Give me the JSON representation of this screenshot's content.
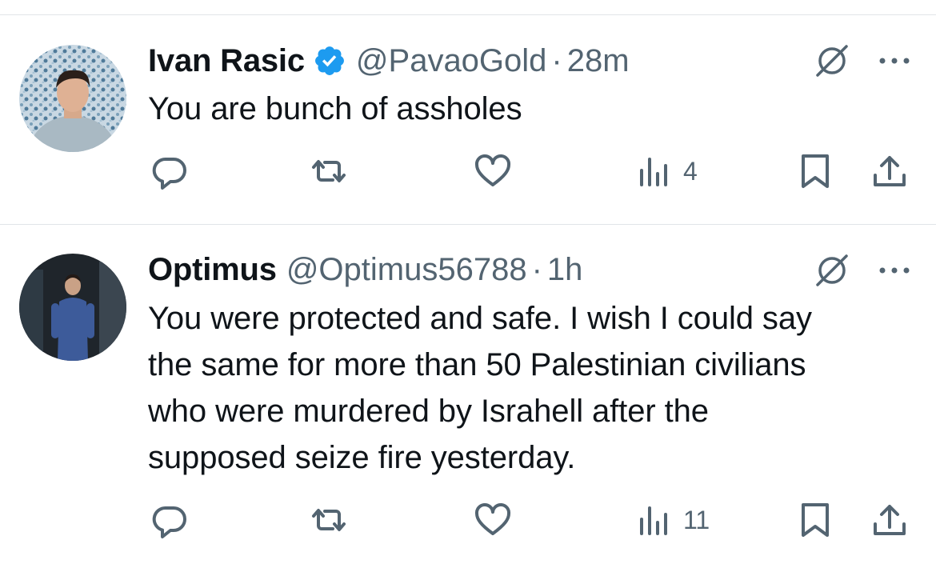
{
  "colors": {
    "text": "#0f1419",
    "muted": "#536471",
    "verified": "#1d9bf0",
    "divider": "#e1e4e8"
  },
  "tweets": [
    {
      "name": "Ivan Rasic",
      "verified": true,
      "handle": "@PavaoGold",
      "separator": "·",
      "time": "28m",
      "text": "You are bunch of assholes",
      "views": "4",
      "icons": [
        "reply-icon",
        "retweet-icon",
        "like-icon",
        "views-icon",
        "bookmark-icon",
        "share-icon",
        "grok-icon",
        "more-icon"
      ]
    },
    {
      "name": "Optimus",
      "verified": false,
      "handle": "@Optimus56788",
      "separator": "·",
      "time": "1h",
      "text_lines": [
        "You were protected and safe. I wish I could say",
        "the same for more than 50 Palestinian civilians",
        "who were murdered by Israhell after the",
        "supposed seize fire yesterday."
      ],
      "views": "11",
      "icons": [
        "reply-icon",
        "retweet-icon",
        "like-icon",
        "views-icon",
        "bookmark-icon",
        "share-icon",
        "grok-icon",
        "more-icon"
      ]
    }
  ]
}
